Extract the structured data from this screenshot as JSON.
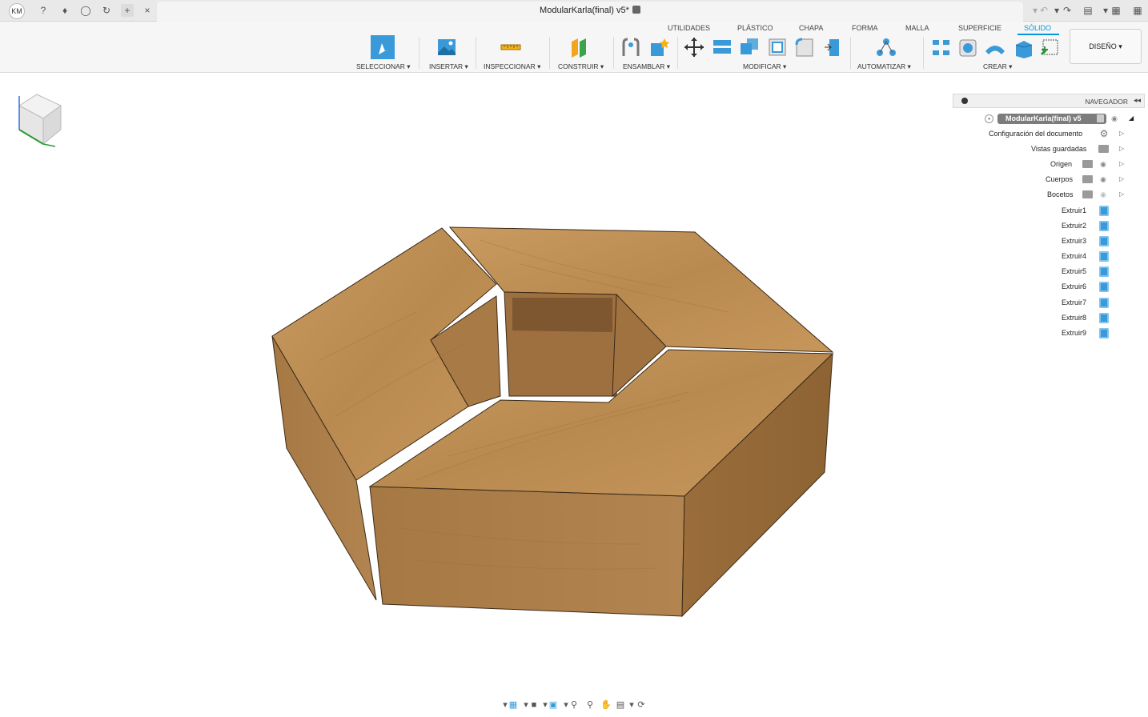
{
  "window": {
    "avatar": "KM",
    "doc_title": "ModularKarla(final) v5*",
    "new_tab_label": "+",
    "close_tab_label": "×"
  },
  "toolbar": {
    "tabs": [
      "SÓLIDO",
      "SUPERFICIE",
      "MALLA",
      "FORMA",
      "CHAPA",
      "PLÁSTICO",
      "UTILIDADES"
    ],
    "active_tab": "SÓLIDO",
    "workspace": "DISEÑO ▾",
    "groups": {
      "crear": "CREAR ▾",
      "automatizar": "AUTOMATIZAR ▾",
      "modificar": "MODIFICAR ▾",
      "ensamblar": "ENSAMBLAR ▾",
      "construir": "CONSTRUIR ▾",
      "inspeccionar": "INSPECCIONAR ▾",
      "insertar": "INSERTAR ▾",
      "seleccionar": "SELECCIONAR ▾"
    }
  },
  "browser": {
    "title": "NAVEGADOR",
    "root": "ModularKarla(final) v5",
    "items": [
      {
        "label": "Configuración del documento",
        "icon": "gear-icon"
      },
      {
        "label": "Vistas guardadas",
        "icon": "folder-icon"
      },
      {
        "label": "Origen",
        "icon": "folder-icon"
      },
      {
        "label": "Cuerpos",
        "icon": "folder-icon"
      },
      {
        "label": "Bocetos",
        "icon": "folder-icon"
      }
    ],
    "features": [
      "Extruir1",
      "Extruir2",
      "Extruir3",
      "Extruir4",
      "Extruir5",
      "Extruir6",
      "Extruir7",
      "Extruir8",
      "Extruir9"
    ]
  },
  "colors": {
    "accent": "#0696d7",
    "wood_top": "#c89a5e",
    "wood_side": "#a97a44",
    "wood_dark": "#8a6132"
  }
}
